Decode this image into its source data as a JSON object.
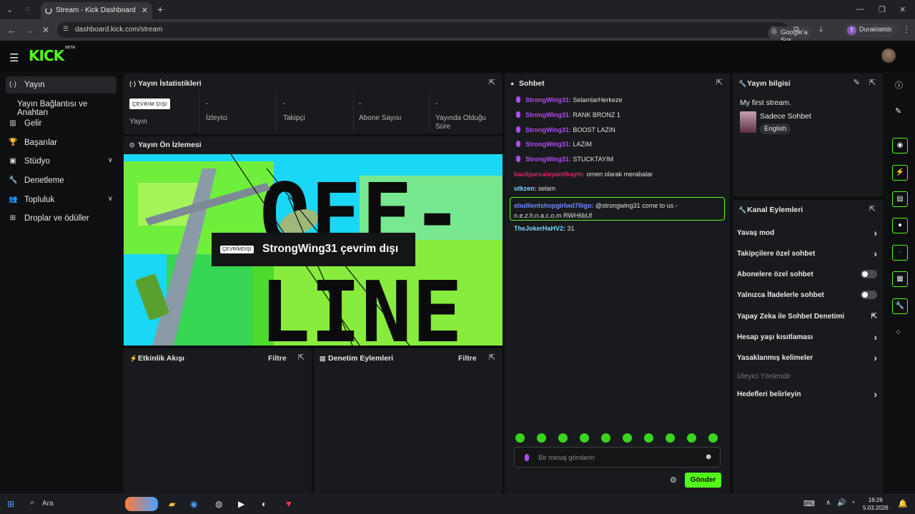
{
  "browser": {
    "tab_title": "Stream - Kick Dashboard",
    "url": "dashboard.kick.com/stream",
    "google_lens": "Google'a Sor",
    "profile_initial": "T",
    "profile_status": "Duraklatıldı",
    "min": "—",
    "max": "❐",
    "close": "✕"
  },
  "header": {
    "logo": "KICK",
    "beta": "BETA"
  },
  "sidebar": {
    "items": [
      {
        "label": "Yayın"
      },
      {
        "label": "Yayın Bağlantısı ve Anahtarı"
      },
      {
        "label": "Gelir"
      },
      {
        "label": "Başarılar"
      },
      {
        "label": "Stüdyo"
      },
      {
        "label": "Denetleme"
      },
      {
        "label": "Topluluk"
      },
      {
        "label": "Droplar ve ödüller"
      }
    ]
  },
  "stats": {
    "title": "Yayın İstatistikleri",
    "status_badge": "ÇEVRİM DIŞI",
    "items": [
      {
        "value": "",
        "label": "Yayın"
      },
      {
        "value": "-",
        "label": "İzleyici"
      },
      {
        "value": "-",
        "label": "Takipçi"
      },
      {
        "value": "-",
        "label": "Abone Sayısı"
      },
      {
        "value": "-",
        "label": "Yayında Olduğu Süre"
      }
    ]
  },
  "preview": {
    "title": "Yayın Ön İzlemesi",
    "offline_badge": "ÇEVRİMDIŞI",
    "offline_text": "StrongWing31 çevrim dışı",
    "art_line1": "OFF-",
    "art_line2": "LINE"
  },
  "activity": {
    "title": "Etkinlik Akışı",
    "filter": "Filtre"
  },
  "moderation": {
    "title": "Denetim Eylemleri",
    "filter": "Filtre"
  },
  "chat": {
    "title": "Sohbet",
    "messages": [
      {
        "user": "StrongWing31",
        "text": "SelamlarHerkeze",
        "color": "#b24bf3",
        "mic": true
      },
      {
        "user": "StrongWing31",
        "text": "RANK BRONZ 1",
        "color": "#b24bf3",
        "mic": true
      },
      {
        "user": "StrongWing31",
        "text": "BOOST LAZIN",
        "color": "#b24bf3",
        "mic": true
      },
      {
        "user": "StrongWing31",
        "text": "LAZIM",
        "color": "#b24bf3",
        "mic": true
      },
      {
        "user": "StrongWing31",
        "text": "STUCKTAYIM",
        "color": "#b24bf3",
        "mic": true
      },
      {
        "user": "bacilparcalayanitkaym",
        "text": "omen olarak merabalar",
        "color": "#e0245e",
        "mic": false
      },
      {
        "user": "utkzen",
        "text": "selam",
        "color": "#7fd4ff",
        "mic": false
      },
      {
        "user": "ebullientshopgirlwd70igo",
        "text": "@strongwing31 come to us - n.e.z.h.n.a.c.o.m RWH6bUf",
        "color": "#6b8cff",
        "mic": false
      },
      {
        "user": "TheJokerHaHV2",
        "text": "31",
        "color": "#7fd4ff",
        "mic": false
      }
    ],
    "input_placeholder": "Bir mesaj gönderin",
    "send": "Gönder"
  },
  "stream_info": {
    "title": "Yayın bilgisi",
    "stream_title": "My first stream.",
    "category": "Sadece Sohbet",
    "language": "English"
  },
  "channel_actions": {
    "title": "Kanal Eylemleri",
    "items": [
      {
        "label": "Yavaş mod",
        "type": "arrow"
      },
      {
        "label": "Takipçilere özel sohbet",
        "type": "arrow"
      },
      {
        "label": "Abonelere özel sohbet",
        "type": "toggle"
      },
      {
        "label": "Yalnızca İfadelerle sohbet",
        "type": "toggle"
      },
      {
        "label": "Yapay Zeka ile Sohbet Denetimi",
        "type": "external"
      },
      {
        "label": "Hesap yaşı kısıtlaması",
        "type": "arrow"
      },
      {
        "label": "Yasaklanmış kelimeler",
        "type": "arrow"
      },
      {
        "label": "İzleyici Yönlendir",
        "type": "disabled"
      },
      {
        "label": "Hedefleri belirleyin",
        "type": "arrow"
      }
    ]
  },
  "taskbar": {
    "search": "Ara",
    "time": "16:26",
    "date": "5.03.2026"
  },
  "colors": {
    "accent": "#53fc18",
    "panel": "#191a1d",
    "bg": "#0e0f11"
  }
}
